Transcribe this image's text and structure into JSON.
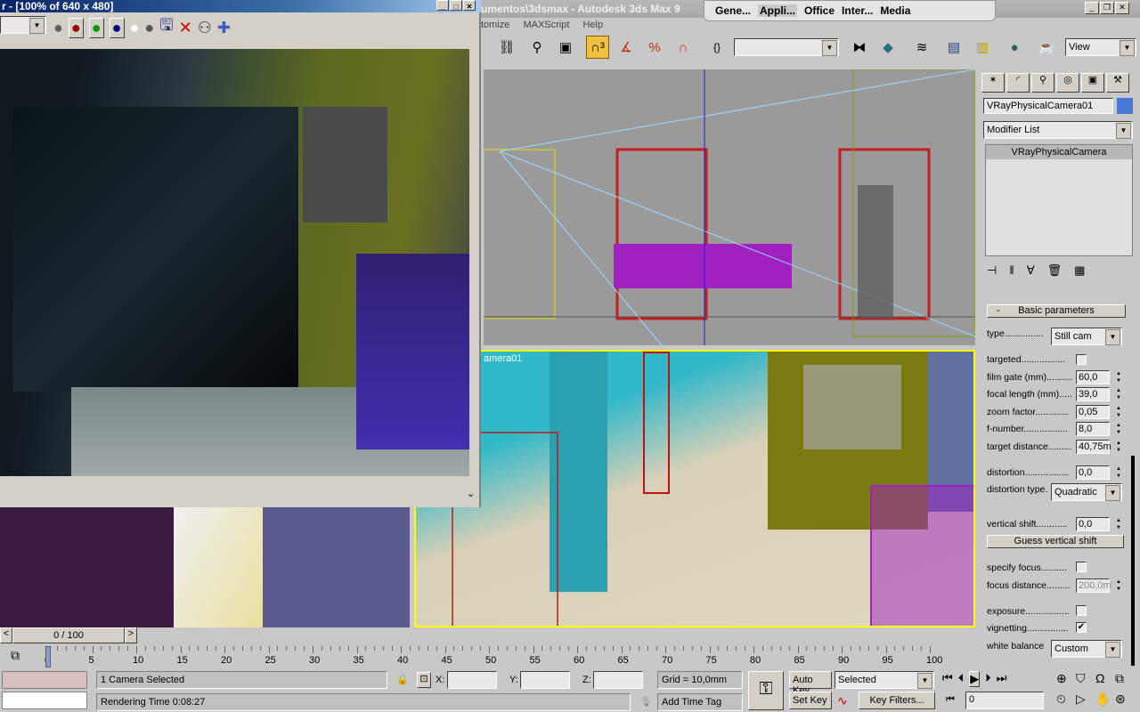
{
  "main_window": {
    "title": "umentos\\3dsmax    - Autodesk 3ds Max 9"
  },
  "tab_popup": {
    "items": [
      "Gene...",
      "Appli...",
      "Office",
      "Inter...",
      "Media"
    ],
    "active": "Appli..."
  },
  "menu": [
    "tomize",
    "MAXScript",
    "Help"
  ],
  "toolbar": {
    "selection_set": "",
    "view_dropdown": "View"
  },
  "render_window": {
    "title": "r - [100% of 640 x 480]",
    "channel_dropdown": ""
  },
  "viewports": {
    "camera_label": "amera01"
  },
  "command_panel": {
    "object_name": "VRayPhysicalCamera01",
    "object_color": "#4a7ad8",
    "modifier_list": "Modifier List",
    "stack_item": "VRayPhysicalCamera",
    "rollout_title": "Basic parameters",
    "rollout_toggle": "-",
    "params": {
      "type_label": "type...............",
      "type_value": "Still cam",
      "targeted_label": "targeted.................",
      "targeted": false,
      "film_gate_label": "film gate (mm)..........",
      "film_gate": "60,0",
      "focal_length_label": "focal length (mm).....",
      "focal_length": "39,0",
      "zoom_factor_label": "zoom factor.............",
      "zoom_factor": "0,05",
      "f_number_label": "f-number.................",
      "f_number": "8,0",
      "target_distance_label": "target distance.........",
      "target_distance": "40,75m",
      "distortion_label": "distortion.................",
      "distortion": "0,0",
      "distortion_type_label": "distortion type.",
      "distortion_type": "Quadratic",
      "vertical_shift_label": "vertical shift............",
      "vertical_shift": "0,0",
      "guess_vertical_shift": "Guess vertical shift",
      "specify_focus_label": "specify focus..........",
      "specify_focus": false,
      "focus_distance_label": "focus distance.........",
      "focus_distance": "200,0m",
      "exposure_label": "exposure.................",
      "exposure": false,
      "vignetting_label": "vignetting................",
      "vignetting": true,
      "white_balance_label": "white balance",
      "white_balance": "Custom"
    }
  },
  "time_slider": {
    "value": "0 / 100",
    "prev": "<",
    "next": ">"
  },
  "trackbar": {
    "ticks": [
      "0",
      "5",
      "10",
      "15",
      "20",
      "25",
      "30",
      "35",
      "40",
      "45",
      "50",
      "55",
      "60",
      "65",
      "70",
      "75",
      "80",
      "85",
      "90",
      "95",
      "100"
    ]
  },
  "status": {
    "selection": "1 Camera Selected",
    "prompt": "Rendering Time  0:08:27",
    "x_label": "X:",
    "y_label": "Y:",
    "z_label": "Z:",
    "x": "",
    "y": "",
    "z": "",
    "grid": "Grid = 10,0mm",
    "add_time_tag": "Add Time Tag",
    "auto_key": "Auto Key",
    "set_key": "Set Key",
    "key_mode": "Selected",
    "key_filters": "Key Filters...",
    "current_frame": "0"
  }
}
